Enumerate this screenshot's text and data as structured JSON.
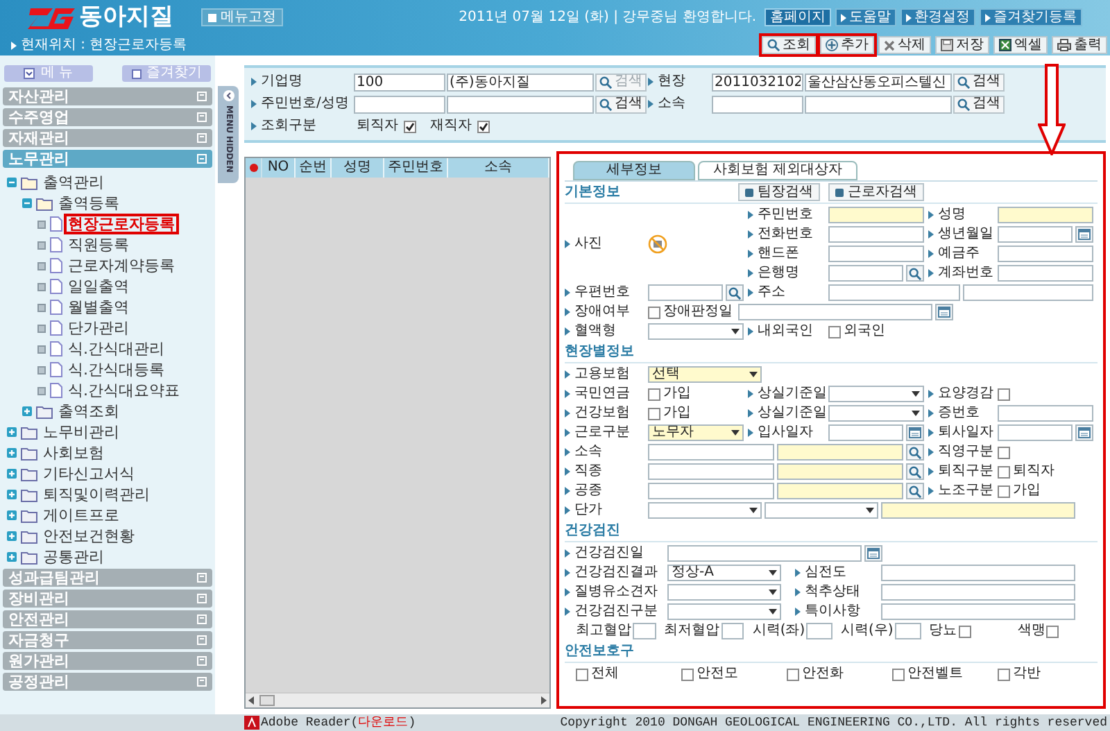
{
  "header": {
    "logo": "동아지질",
    "pin_button": "메뉴고정",
    "greeting": "2011년 07월 12일 (화) | 강무중님 환영합니다.",
    "links": [
      {
        "label": "홈페이지",
        "selected": true
      },
      {
        "label": "도움말",
        "selected": false
      },
      {
        "label": "환경설정",
        "selected": false
      },
      {
        "label": "즐겨찾기등록",
        "selected": false
      }
    ],
    "location": "현재위치 : 현장근로자등록",
    "toolbar": [
      {
        "kind": "search",
        "label": "조회",
        "highlighted": true
      },
      {
        "kind": "add",
        "label": "추가",
        "highlighted": true
      },
      {
        "kind": "delete",
        "label": "삭제",
        "highlighted": false
      },
      {
        "kind": "save",
        "label": "저장",
        "highlighted": false
      },
      {
        "kind": "excel",
        "label": "엑셀",
        "highlighted": false
      },
      {
        "kind": "print",
        "label": "출력",
        "highlighted": false
      }
    ]
  },
  "sidebar": {
    "buttons": [
      {
        "kind": "menu",
        "label": "메 뉴"
      },
      {
        "kind": "favorites",
        "label": "즐겨찾기"
      }
    ],
    "groups": [
      {
        "label": "자산관리",
        "expanded": false
      },
      {
        "label": "수주영업",
        "expanded": false
      },
      {
        "label": "자재관리",
        "expanded": false
      },
      {
        "label": "노무관리",
        "expanded": true,
        "children": [
          {
            "label": "출역관리",
            "kind": "folder",
            "expanded": true,
            "children": [
              {
                "label": "출역등록",
                "kind": "folder",
                "expanded": true,
                "children": [
                  {
                    "label": "현장근로자등록",
                    "kind": "page",
                    "selected": true
                  },
                  {
                    "label": "직원등록",
                    "kind": "page",
                    "selected": false
                  },
                  {
                    "label": "근로자계약등록",
                    "kind": "page",
                    "selected": false
                  },
                  {
                    "label": "일일출역",
                    "kind": "page",
                    "selected": false
                  },
                  {
                    "label": "월별출역",
                    "kind": "page",
                    "selected": false
                  },
                  {
                    "label": "단가관리",
                    "kind": "page",
                    "selected": false
                  },
                  {
                    "label": "식.간식대관리",
                    "kind": "page",
                    "selected": false
                  },
                  {
                    "label": "식.간식대등록",
                    "kind": "page",
                    "selected": false
                  },
                  {
                    "label": "식.간식대요약표",
                    "kind": "page",
                    "selected": false
                  }
                ]
              },
              {
                "label": "출역조회",
                "kind": "folder",
                "expanded": false
              }
            ]
          },
          {
            "label": "노무비관리",
            "kind": "folder",
            "expanded": false
          },
          {
            "label": "사회보험",
            "kind": "folder",
            "expanded": false
          },
          {
            "label": "기타신고서식",
            "kind": "folder",
            "expanded": false
          },
          {
            "label": "퇴직및이력관리",
            "kind": "folder",
            "expanded": false
          },
          {
            "label": "게이트프로",
            "kind": "folder",
            "expanded": false
          },
          {
            "label": "안전보건현황",
            "kind": "folder",
            "expanded": false
          },
          {
            "label": "공통관리",
            "kind": "folder",
            "expanded": false
          }
        ]
      },
      {
        "label": "성과급팀관리",
        "expanded": false
      },
      {
        "label": "장비관리",
        "expanded": false
      },
      {
        "label": "안전관리",
        "expanded": false
      },
      {
        "label": "자금청구",
        "expanded": false
      },
      {
        "label": "원가관리",
        "expanded": false
      },
      {
        "label": "공정관리",
        "expanded": false
      }
    ],
    "hide_tab": "MENU HIDDEN"
  },
  "search": {
    "rows": [
      {
        "kind": "fields",
        "pairs": [
          {
            "label": "기업명",
            "inputs": [
              {
                "kind": "text",
                "value": "100"
              },
              {
                "kind": "text",
                "value": "(주)동아지질"
              }
            ],
            "button": {
              "label": "검색",
              "disabled": true
            }
          },
          {
            "label": "현장",
            "inputs": [
              {
                "kind": "text",
                "value": "2011032102"
              },
              {
                "kind": "text",
                "value": "울산삼산동오피스텔신"
              }
            ],
            "button": {
              "label": "검색",
              "disabled": false
            }
          }
        ]
      },
      {
        "kind": "fields",
        "pairs": [
          {
            "label": "주민번호/성명",
            "inputs": [
              {
                "kind": "text"
              },
              {
                "kind": "text"
              }
            ],
            "button": {
              "label": "검색",
              "disabled": false
            }
          },
          {
            "label": "소속",
            "inputs": [
              {
                "kind": "text"
              },
              {
                "kind": "text"
              }
            ],
            "button": {
              "label": "검색",
              "disabled": false
            }
          }
        ]
      },
      {
        "kind": "checks",
        "label": "조회구분",
        "checks": [
          {
            "label": "퇴직자",
            "checked": true
          },
          {
            "label": "재직자",
            "checked": true
          }
        ]
      }
    ]
  },
  "grid": {
    "columns": [
      "NO",
      "순번",
      "성명",
      "주민번호",
      "소속"
    ]
  },
  "detail": {
    "highlighted": true,
    "tabs": [
      {
        "label": "세부정보",
        "selected": true
      },
      {
        "label": "사회보험 제외대상자",
        "selected": false
      }
    ],
    "sections": [
      {
        "kind": "basic",
        "title": "기본정보",
        "buttons": [
          "팀장검색",
          "근로자검색"
        ],
        "photo": {
          "label": "사진"
        },
        "photo_rows": [
          {
            "middle": {
              "label": "주민번호",
              "controls": [
                {
                  "kind": "input",
                  "required": true
                }
              ]
            },
            "right": {
              "label": "성명",
              "controls": [
                {
                  "kind": "input",
                  "required": true
                }
              ]
            }
          },
          {
            "middle": {
              "label": "전화번호",
              "controls": [
                {
                  "kind": "input",
                  "required": false
                }
              ]
            },
            "right": {
              "label": "생년월일",
              "controls": [
                {
                  "kind": "input",
                  "required": false
                },
                {
                  "kind": "calendar"
                }
              ]
            }
          },
          {
            "middle": {
              "label": "핸드폰",
              "controls": [
                {
                  "kind": "input",
                  "required": false
                }
              ]
            },
            "right": {
              "label": "예금주",
              "controls": [
                {
                  "kind": "input",
                  "required": false
                }
              ]
            }
          },
          {
            "middle": {
              "label": "은행명",
              "controls": [
                {
                  "kind": "input",
                  "required": false
                },
                {
                  "kind": "lookup"
                }
              ]
            },
            "right": {
              "label": "계좌번호",
              "controls": [
                {
                  "kind": "input",
                  "required": false
                }
              ]
            }
          }
        ],
        "rows": [
          {
            "kind": "slots",
            "left": {
              "label": "우편번호",
              "controls": [
                {
                  "kind": "input",
                  "required": false
                },
                {
                  "kind": "lookup"
                }
              ]
            },
            "middle": {
              "label": "주소",
              "controls": [
                {
                  "kind": "input",
                  "required": false
                },
                {
                  "kind": "input",
                  "required": false
                }
              ]
            }
          },
          {
            "kind": "slots",
            "left": {
              "label": "장애여부",
              "controls": [
                {
                  "kind": "check",
                  "text": "장애판정일",
                  "checked": false
                },
                {
                  "kind": "input",
                  "required": false
                },
                {
                  "kind": "calendar"
                }
              ]
            }
          },
          {
            "kind": "slots",
            "left": {
              "label": "혈액형",
              "controls": [
                {
                  "kind": "select",
                  "required": false
                }
              ]
            },
            "middle": {
              "label": "내외국인",
              "controls": [
                {
                  "kind": "check",
                  "text": "외국인",
                  "checked": false
                }
              ]
            }
          }
        ]
      },
      {
        "kind": "site",
        "title": "현장별정보",
        "rows": [
          {
            "kind": "slots",
            "left": {
              "label": "고용보험",
              "controls": [
                {
                  "kind": "select",
                  "value": "선택",
                  "required": true
                }
              ]
            }
          },
          {
            "kind": "slots",
            "left": {
              "label": "국민연금",
              "controls": [
                {
                  "kind": "check",
                  "text": "가입",
                  "checked": false
                }
              ]
            },
            "middle": {
              "label": "상실기준일",
              "controls": [
                {
                  "kind": "select",
                  "required": false
                }
              ]
            },
            "right": {
              "label": "요양경감",
              "controls": [
                {
                  "kind": "check",
                  "checked": false
                }
              ]
            }
          },
          {
            "kind": "slots",
            "left": {
              "label": "건강보험",
              "controls": [
                {
                  "kind": "check",
                  "text": "가입",
                  "checked": false
                }
              ]
            },
            "middle": {
              "label": "상실기준일",
              "controls": [
                {
                  "kind": "select",
                  "required": false
                }
              ]
            },
            "right": {
              "label": "증번호",
              "controls": [
                {
                  "kind": "input",
                  "required": false
                }
              ]
            }
          },
          {
            "kind": "slots",
            "left": {
              "label": "근로구분",
              "controls": [
                {
                  "kind": "select",
                  "value": "노무자",
                  "required": true
                }
              ]
            },
            "middle": {
              "label": "입사일자",
              "controls": [
                {
                  "kind": "input",
                  "required": false
                },
                {
                  "kind": "calendar"
                }
              ]
            },
            "right": {
              "label": "퇴사일자",
              "controls": [
                {
                  "kind": "input",
                  "required": false
                },
                {
                  "kind": "calendar"
                }
              ]
            }
          },
          {
            "kind": "slots",
            "left": {
              "label": "소속",
              "controls": [
                {
                  "kind": "input",
                  "required": false
                },
                {
                  "kind": "input",
                  "required": true
                },
                {
                  "kind": "lookup"
                }
              ]
            },
            "right": {
              "label": "직영구분",
              "controls": [
                {
                  "kind": "check",
                  "checked": false
                }
              ]
            }
          },
          {
            "kind": "slots",
            "left": {
              "label": "직종",
              "controls": [
                {
                  "kind": "input",
                  "required": false
                },
                {
                  "kind": "input",
                  "required": true
                },
                {
                  "kind": "lookup"
                }
              ]
            },
            "right": {
              "label": "퇴직구분",
              "controls": [
                {
                  "kind": "check",
                  "text": "퇴직자",
                  "checked": false
                }
              ]
            }
          },
          {
            "kind": "slots",
            "left": {
              "label": "공종",
              "controls": [
                {
                  "kind": "input",
                  "required": false
                },
                {
                  "kind": "input",
                  "required": true
                },
                {
                  "kind": "lookup"
                }
              ]
            },
            "right": {
              "label": "노조구분",
              "controls": [
                {
                  "kind": "check",
                  "text": "가입",
                  "checked": false
                }
              ]
            }
          },
          {
            "kind": "slots",
            "left": {
              "label": "단가",
              "controls": [
                {
                  "kind": "select",
                  "required": false
                },
                {
                  "kind": "select",
                  "required": false
                },
                {
                  "kind": "input",
                  "required": true
                }
              ]
            }
          }
        ]
      },
      {
        "kind": "health",
        "title": "건강검진",
        "rows": [
          {
            "kind": "slots",
            "left": {
              "label": "건강검진일",
              "controls": [
                {
                  "kind": "input",
                  "required": false
                },
                {
                  "kind": "calendar"
                }
              ]
            }
          },
          {
            "kind": "slots",
            "left": {
              "label": "건강검진결과",
              "controls": [
                {
                  "kind": "select",
                  "value": "정상-A",
                  "required": false
                }
              ]
            },
            "middle": {
              "label": "심전도",
              "controls": [
                {
                  "kind": "input",
                  "required": false
                }
              ]
            }
          },
          {
            "kind": "slots",
            "left": {
              "label": "질병유소견자",
              "controls": [
                {
                  "kind": "select",
                  "required": false
                }
              ]
            },
            "middle": {
              "label": "척추상태",
              "controls": [
                {
                  "kind": "input",
                  "required": false
                }
              ]
            }
          },
          {
            "kind": "slots",
            "left": {
              "label": "건강검진구분",
              "controls": [
                {
                  "kind": "select",
                  "required": false
                }
              ]
            },
            "middle": {
              "label": "특이사항",
              "controls": [
                {
                  "kind": "input",
                  "required": false
                }
              ]
            }
          },
          {
            "kind": "inline",
            "items": [
              {
                "label": "최고혈압",
                "controls": [
                  {
                    "kind": "input",
                    "required": false
                  }
                ]
              },
              {
                "label": "최저혈압",
                "controls": [
                  {
                    "kind": "input",
                    "required": false
                  }
                ]
              },
              {
                "label": "시력(좌)",
                "controls": [
                  {
                    "kind": "input",
                    "required": false
                  }
                ]
              },
              {
                "label": "시력(우)",
                "controls": [
                  {
                    "kind": "input",
                    "required": false
                  }
                ]
              },
              {
                "label": "당뇨",
                "controls": [
                  {
                    "kind": "check",
                    "checked": false
                  }
                ]
              },
              {
                "label": "색맹",
                "controls": [
                  {
                    "kind": "check",
                    "checked": false
                  }
                ]
              }
            ]
          }
        ]
      },
      {
        "kind": "gear",
        "title": "안전보호구",
        "rows": [
          {
            "kind": "inline",
            "items": [
              {
                "controls": [
                  {
                    "kind": "check",
                    "text": "전체",
                    "checked": false
                  }
                ]
              },
              {
                "controls": [
                  {
                    "kind": "check",
                    "text": "안전모",
                    "checked": false
                  }
                ]
              },
              {
                "controls": [
                  {
                    "kind": "check",
                    "text": "안전화",
                    "checked": false
                  }
                ]
              },
              {
                "controls": [
                  {
                    "kind": "check",
                    "text": "안전벨트",
                    "checked": false
                  }
                ]
              },
              {
                "controls": [
                  {
                    "kind": "check",
                    "text": "각반",
                    "checked": false
                  }
                ]
              }
            ]
          }
        ]
      }
    ]
  },
  "footer": {
    "adobe": {
      "label": "Adobe Reader(",
      "link": "다운로드",
      "suffix": ")"
    },
    "copyright": "Copyright 2010 DONGAH GEOLOGICAL ENGINEERING CO.,LTD. All rights reserved"
  }
}
